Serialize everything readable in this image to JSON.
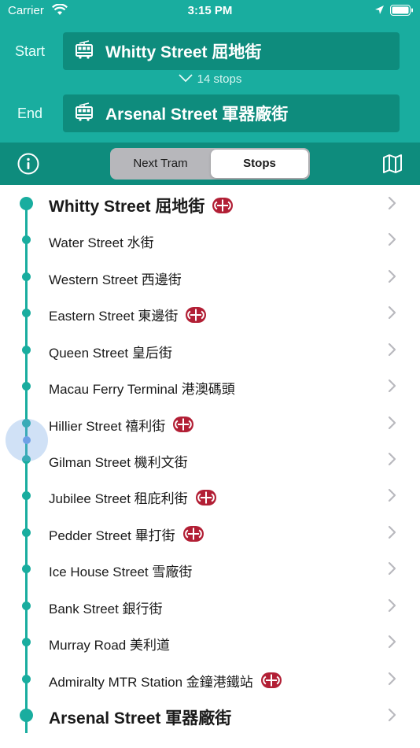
{
  "status_bar": {
    "carrier": "Carrier",
    "time": "3:15 PM"
  },
  "route": {
    "start_label": "Start",
    "start_stop": "Whitty Street 屈地街",
    "stops_count": "14  stops",
    "end_label": "End",
    "end_stop": "Arsenal Street 軍器廠街"
  },
  "toolbar": {
    "tabs": [
      {
        "label": "Next Tram",
        "selected": false
      },
      {
        "label": "Stops",
        "selected": true
      }
    ]
  },
  "stops": [
    {
      "name": "Whitty Street 屈地街",
      "mtr": true,
      "terminal": true
    },
    {
      "name": "Water Street 水街",
      "mtr": false
    },
    {
      "name": "Western Street 西邊街",
      "mtr": false
    },
    {
      "name": "Eastern Street 東邊街",
      "mtr": true
    },
    {
      "name": "Queen Street 皇后街",
      "mtr": false
    },
    {
      "name": "Macau Ferry Terminal 港澳碼頭",
      "mtr": false
    },
    {
      "name": "Hillier Street 禧利街",
      "mtr": true
    },
    {
      "name": "Gilman Street 機利文街",
      "mtr": false
    },
    {
      "name": "Jubilee Street 租庇利街",
      "mtr": true
    },
    {
      "name": "Pedder Street 畢打街",
      "mtr": true
    },
    {
      "name": "Ice House Street 雪廠街",
      "mtr": false
    },
    {
      "name": "Bank Street 銀行街",
      "mtr": false
    },
    {
      "name": "Murray Road 美利道",
      "mtr": false
    },
    {
      "name": "Admiralty MTR Station 金鐘港鐵站",
      "mtr": true
    },
    {
      "name": "Arsenal Street 軍器廠街",
      "mtr": false,
      "terminal": true
    }
  ],
  "colors": {
    "accent": "#19ad9f",
    "accent_dark": "#0e8c7d",
    "mtr": "#b21f35"
  },
  "icons": [
    "wifi-icon",
    "location-arrow-icon",
    "battery-icon",
    "tram-icon",
    "chevron-down-icon",
    "info-icon",
    "map-icon",
    "mtr-logo-icon",
    "chevron-right-icon"
  ]
}
